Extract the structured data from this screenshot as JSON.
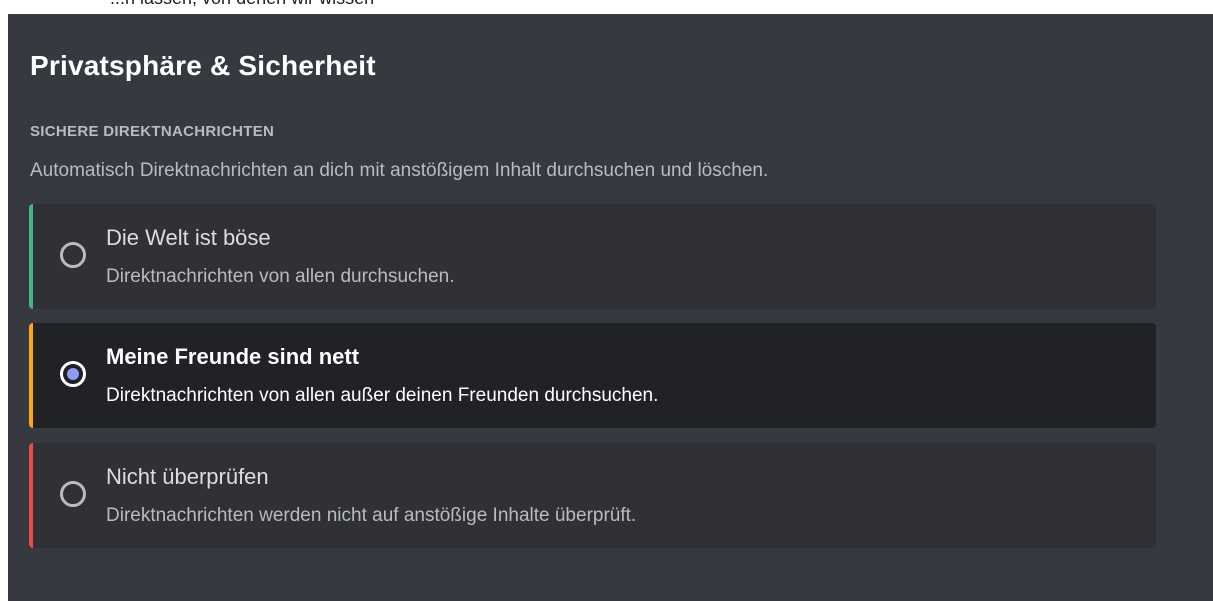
{
  "header": {
    "clipped_text": "...n lassen, von denen wir wissen"
  },
  "settings": {
    "title": "Privatsphäre & Sicherheit",
    "section_header": "SICHERE DIREKTNACHRICHTEN",
    "section_description": "Automatisch Direktnachrichten an dich mit anstößigem Inhalt durchsuchen und löschen.",
    "options": [
      {
        "title": "Die Welt ist böse",
        "description": "Direktnachrichten von allen durchsuchen.",
        "selected": false,
        "accent_color": "#43b581"
      },
      {
        "title": "Meine Freunde sind nett",
        "description": "Direktnachrichten von allen außer deinen Freunden durchsuchen.",
        "selected": true,
        "accent_color": "#faa61a"
      },
      {
        "title": "Nicht überprüfen",
        "description": "Direktnachrichten werden nicht auf anstößige Inhalte überprüft.",
        "selected": false,
        "accent_color": "#f04747"
      }
    ]
  },
  "colors": {
    "background": "#36393f",
    "option_background": "#2f3136",
    "option_selected_background": "#202225",
    "radio_selected_fill": "#8e9cf5"
  }
}
